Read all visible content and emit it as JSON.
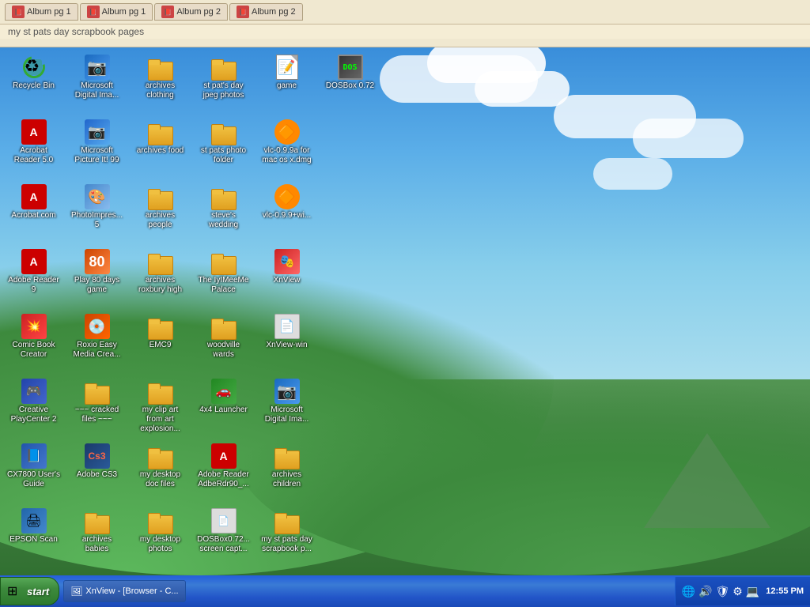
{
  "top_bar": {
    "tabs": [
      {
        "label": "Album pg 1",
        "id": "album-pg1-a"
      },
      {
        "label": "Album pg 1",
        "id": "album-pg1-b"
      },
      {
        "label": "Album pg 2",
        "id": "album-pg2-a"
      },
      {
        "label": "Album pg 2",
        "id": "album-pg2-b"
      }
    ],
    "subtitle": "my st pats day scrapbook pages"
  },
  "desktop_icons": [
    {
      "id": "recycle-bin",
      "label": "Recycle Bin",
      "type": "recycle",
      "col": 0,
      "row": 0
    },
    {
      "id": "ms-digital-img1",
      "label": "Microsoft Digital Ima...",
      "type": "msapp",
      "col": 1,
      "row": 0
    },
    {
      "id": "archives-clothing",
      "label": "archives clothing",
      "type": "folder",
      "col": 2,
      "row": 0
    },
    {
      "id": "st-pats-day-jpeg",
      "label": "st pat's day jpeg photos",
      "type": "folder",
      "col": 3,
      "row": 0
    },
    {
      "id": "game",
      "label": "game",
      "type": "text-doc",
      "col": 4,
      "row": 0
    },
    {
      "id": "dosbox-072",
      "label": "DOSBox 0.72",
      "type": "dosbox",
      "col": 5,
      "row": 0
    },
    {
      "id": "acrobat-reader-5",
      "label": "Acrobat Reader 5.0",
      "type": "acrobat",
      "col": 0,
      "row": 1
    },
    {
      "id": "ms-picture-it-99",
      "label": "Microsoft Picture It! 99",
      "type": "ms-picture",
      "col": 1,
      "row": 1
    },
    {
      "id": "archives-food",
      "label": "archives food",
      "type": "folder",
      "col": 2,
      "row": 1
    },
    {
      "id": "st-pats-photo-folder",
      "label": "st pats photo folder",
      "type": "folder",
      "col": 3,
      "row": 1
    },
    {
      "id": "vlc-mac",
      "label": "vlc-0.9.9a for mac os x.dmg",
      "type": "vlc",
      "col": 4,
      "row": 1
    },
    {
      "id": "acrobat-com",
      "label": "Acrobat.com",
      "type": "acrobat-com",
      "col": 0,
      "row": 2
    },
    {
      "id": "photoimpres-5",
      "label": "PhotoImpres... 5",
      "type": "photo-impress",
      "col": 1,
      "row": 2
    },
    {
      "id": "archives-people",
      "label": "archives people",
      "type": "folder",
      "col": 2,
      "row": 2
    },
    {
      "id": "steves-wedding",
      "label": "steve's wedding",
      "type": "folder",
      "col": 3,
      "row": 2
    },
    {
      "id": "vlc-win",
      "label": "vlc-0.9.9+wi...",
      "type": "vlc",
      "col": 4,
      "row": 2
    },
    {
      "id": "adobe-reader-9",
      "label": "Adobe Reader 9",
      "type": "acrobat",
      "col": 0,
      "row": 3
    },
    {
      "id": "play-80-days",
      "label": "Play 80 days game",
      "type": "game-icon",
      "col": 1,
      "row": 3
    },
    {
      "id": "archives-roxbury",
      "label": "archives roxbury high",
      "type": "folder",
      "col": 2,
      "row": 3
    },
    {
      "id": "iyimeeme-palace",
      "label": "The IyIMeeMe Palace",
      "type": "folder",
      "col": 3,
      "row": 3
    },
    {
      "id": "xnview",
      "label": "XnView",
      "type": "xnview",
      "col": 4,
      "row": 3
    },
    {
      "id": "comic-book-creator",
      "label": "Comic Book Creator",
      "type": "comic-book",
      "col": 0,
      "row": 4
    },
    {
      "id": "roxio-easy-media",
      "label": "Roxio Easy Media Crea...",
      "type": "roxio",
      "col": 1,
      "row": 4
    },
    {
      "id": "emc9",
      "label": "EMC9",
      "type": "folder",
      "col": 2,
      "row": 4
    },
    {
      "id": "woodville-wards",
      "label": "woodville wards",
      "type": "folder",
      "col": 3,
      "row": 4
    },
    {
      "id": "xnview-win",
      "label": "XnView-win",
      "type": "xnview-file",
      "col": 4,
      "row": 4
    },
    {
      "id": "creative-playcenter",
      "label": "Creative PlayCenter 2",
      "type": "creative",
      "col": 0,
      "row": 5
    },
    {
      "id": "cracked-files",
      "label": "~~~ cracked files ~~~",
      "type": "folder",
      "col": 1,
      "row": 5
    },
    {
      "id": "my-clip-art",
      "label": "my clip art from art explosion...",
      "type": "folder",
      "col": 2,
      "row": 5
    },
    {
      "id": "4x4-launcher",
      "label": "4x4 Launcher",
      "type": "4x4",
      "col": 3,
      "row": 5
    },
    {
      "id": "ms-digital-img2",
      "label": "Microsoft Digital Ima...",
      "type": "msapp",
      "col": 4,
      "row": 5
    },
    {
      "id": "cx7800-guide",
      "label": "CX7800 User's Guide",
      "type": "epson",
      "col": 0,
      "row": 6
    },
    {
      "id": "adobe-cs3",
      "label": "Adobe CS3",
      "type": "adobe-cs3",
      "col": 1,
      "row": 6
    },
    {
      "id": "my-desktop-doc",
      "label": "my desktop doc files",
      "type": "folder",
      "col": 2,
      "row": 6
    },
    {
      "id": "adobe-reader-adbe",
      "label": "Adobe Reader AdbeRdr90_...",
      "type": "adobe-reader-file",
      "col": 3,
      "row": 6
    },
    {
      "id": "archives-children",
      "label": "archives children",
      "type": "folder",
      "col": 4,
      "row": 6
    },
    {
      "id": "epson-scan",
      "label": "EPSON Scan",
      "type": "epson-scan",
      "col": 0,
      "row": 7
    },
    {
      "id": "archives-babies",
      "label": "archives babies",
      "type": "folder",
      "col": 1,
      "row": 7
    },
    {
      "id": "my-desktop-photos",
      "label": "my desktop photos",
      "type": "folder",
      "col": 2,
      "row": 7
    },
    {
      "id": "dosbox-screen-capt",
      "label": "DOSBox0.72... screen capt...",
      "type": "dosbox-file",
      "col": 3,
      "row": 7
    },
    {
      "id": "st-pats-scrapbook",
      "label": "my st pats day scrapbook p...",
      "type": "folder",
      "col": 4,
      "row": 7
    }
  ],
  "taskbar": {
    "start_label": "start",
    "apps": [
      {
        "label": "XnView - [Browser - C...",
        "active": true
      }
    ],
    "clock": "12:55 PM"
  }
}
